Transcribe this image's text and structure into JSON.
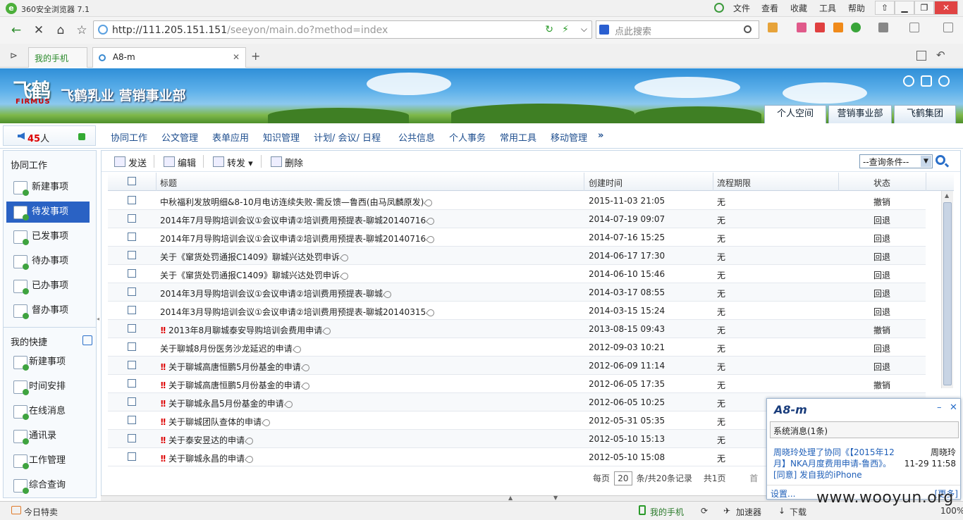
{
  "browser": {
    "title": "360安全浏览器 7.1",
    "menus": [
      "文件",
      "查看",
      "收藏",
      "工具",
      "帮助"
    ],
    "url_host": "http://111.205.151.151",
    "url_path": "/seeyon/main.do?method=index",
    "search_placeholder": "点此搜索",
    "tabs": [
      {
        "label": "我的手机"
      },
      {
        "label": "A8-m"
      }
    ],
    "new_tab": "+"
  },
  "banner": {
    "logo_text": "飞鹤",
    "logo_sub": "FIRMUS",
    "company": "飞鹤乳业 营销事业部",
    "tabs": [
      "个人空间",
      "营销事业部",
      "飞鹤集团"
    ]
  },
  "online": {
    "count": "45",
    "suffix": "人"
  },
  "topnav": [
    "协同工作",
    "公文管理",
    "表单应用",
    "知识管理",
    "计划/ 会议/ 日程",
    "公共信息",
    "个人事务",
    "常用工具",
    "移动管理",
    "»"
  ],
  "sidebar": {
    "section1": "协同工作",
    "items1": [
      "新建事项",
      "待发事项",
      "已发事项",
      "待办事项",
      "已办事项",
      "督办事项"
    ],
    "section2": "我的快捷",
    "items2": [
      "新建事项",
      "时间安排",
      "在线消息",
      "通讯录",
      "工作管理",
      "综合查询"
    ]
  },
  "toolbar": {
    "send": "发送",
    "edit": "编辑",
    "forward": "转发",
    "delete": "删除",
    "query_select": "--查询条件--"
  },
  "grid": {
    "headers": [
      "标题",
      "创建时间",
      "流程期限",
      "状态"
    ],
    "rows": [
      {
        "urgent": false,
        "title": "中秋福利发放明细&8-10月电访连续失败-需反馈—鲁西(由马凤麟原发)",
        "time": "2015-11-03 21:05",
        "deadline": "无",
        "status": "撤销"
      },
      {
        "urgent": false,
        "title": "2014年7月导购培训会议①会议申请②培训费用预提表-聊城20140716",
        "time": "2014-07-19 09:07",
        "deadline": "无",
        "status": "回退"
      },
      {
        "urgent": false,
        "title": "2014年7月导购培训会议①会议申请②培训费用预提表-聊城20140716",
        "time": "2014-07-16 15:25",
        "deadline": "无",
        "status": "回退"
      },
      {
        "urgent": false,
        "title": "关于《窜货处罚通报C1409》聊城兴达处罚申诉",
        "time": "2014-06-17 17:30",
        "deadline": "无",
        "status": "回退"
      },
      {
        "urgent": false,
        "title": "关于《窜货处罚通报C1409》聊城兴达处罚申诉",
        "time": "2014-06-10 15:46",
        "deadline": "无",
        "status": "回退"
      },
      {
        "urgent": false,
        "title": "2014年3月导购培训会议①会议申请②培训费用预提表-聊城",
        "time": "2014-03-17 08:55",
        "deadline": "无",
        "status": "回退"
      },
      {
        "urgent": false,
        "title": "2014年3月导购培训会议①会议申请②培训费用预提表-聊城20140315",
        "time": "2014-03-15 15:24",
        "deadline": "无",
        "status": "回退"
      },
      {
        "urgent": true,
        "title": "2013年8月聊城泰安导购培训会费用申请",
        "time": "2013-08-15 09:43",
        "deadline": "无",
        "status": "撤销"
      },
      {
        "urgent": false,
        "title": "关于聊城8月份医务沙龙延迟的申请",
        "time": "2012-09-03 10:21",
        "deadline": "无",
        "status": "回退"
      },
      {
        "urgent": true,
        "title": "关于聊城高唐恒鹏5月份基金的申请",
        "time": "2012-06-09 11:14",
        "deadline": "无",
        "status": "回退"
      },
      {
        "urgent": true,
        "title": "关于聊城高唐恒鹏5月份基金的申请",
        "time": "2012-06-05 17:35",
        "deadline": "无",
        "status": "撤销"
      },
      {
        "urgent": true,
        "title": "关于聊城永昌5月份基金的申请",
        "time": "2012-06-05 10:25",
        "deadline": "无",
        "status": ""
      },
      {
        "urgent": true,
        "title": "关于聊城团队查体的申请",
        "time": "2012-05-31 05:35",
        "deadline": "无",
        "status": ""
      },
      {
        "urgent": true,
        "title": "关于泰安昱达的申请",
        "time": "2012-05-10 15:13",
        "deadline": "无",
        "status": ""
      },
      {
        "urgent": true,
        "title": "关于聊城永昌的申请",
        "time": "2012-05-10 15:08",
        "deadline": "无",
        "status": ""
      }
    ]
  },
  "pager": {
    "per_page_label": "每页",
    "per_page": "20",
    "summary": "条/共20条记录",
    "pages": "共1页",
    "first": "首"
  },
  "popup": {
    "logo": "A8-m",
    "subject": "系统消息(1条)",
    "message": "周晓玲处理了协同《【2015年12月】NKA月度费用申请-鲁西》。[同意] 发自我的iPhone",
    "sender": "周晓玲",
    "time": "11-29 11:58",
    "settings": "设置...",
    "more": "[更多]"
  },
  "status": {
    "today": "今日特卖",
    "phone": "我的手机",
    "accel": "加速器",
    "download": "下载",
    "zoom": "100%"
  },
  "watermark": "www.wooyun.org"
}
